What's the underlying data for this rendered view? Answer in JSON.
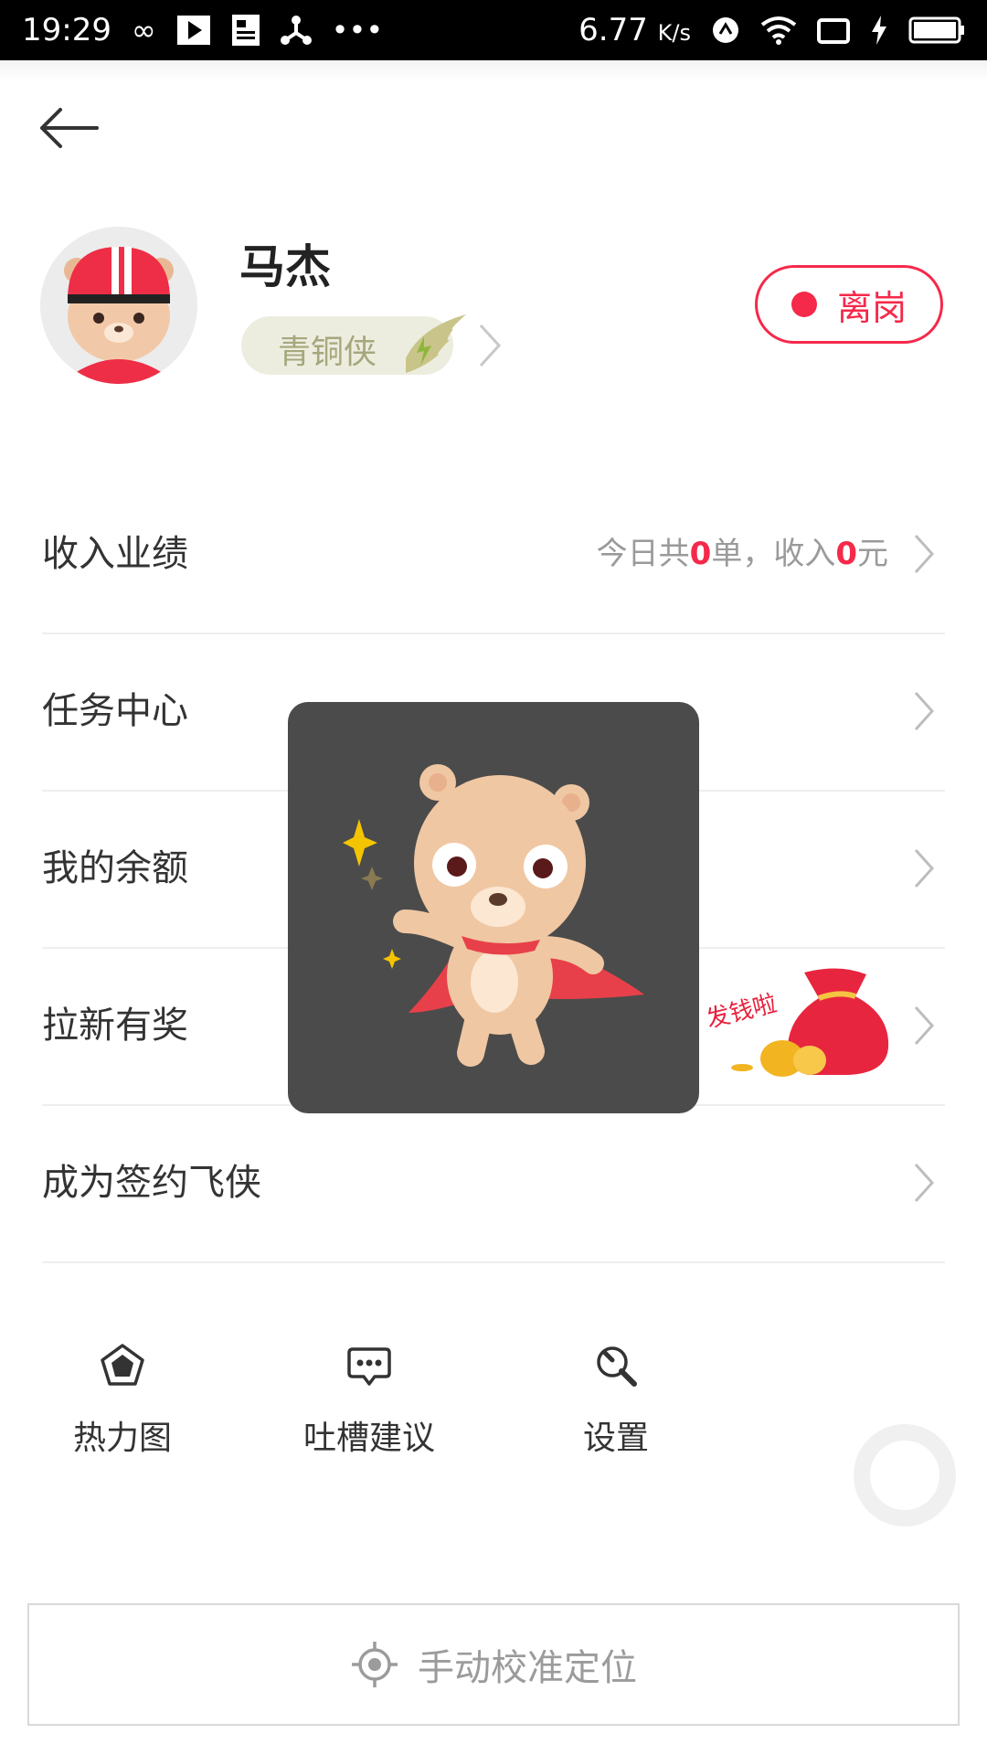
{
  "statusbar": {
    "time": "19:29",
    "speed": "6.77",
    "speed_unit": "K/s",
    "icons": [
      "infinity-icon",
      "play-icon",
      "news-icon",
      "share-node-icon",
      "more-dots-icon",
      "data-arrows-icon",
      "wifi-icon",
      "screen-icon",
      "charging-icon",
      "battery-icon"
    ]
  },
  "profile": {
    "name": "马杰",
    "level": "青铜侠",
    "status_button": "离岗"
  },
  "menu": {
    "income": {
      "label": "收入业绩",
      "summary_prefix": "今日共",
      "orders": "0",
      "summary_mid": "单，收入",
      "amount": "0",
      "summary_suffix": "元"
    },
    "tasks": "任务中心",
    "balance": "我的余额",
    "referral": "拉新有奖",
    "referral_badge": "发钱啦",
    "contract": "成为签约飞侠"
  },
  "quick_actions": {
    "heatmap": "热力图",
    "feedback": "吐槽建议",
    "settings": "设置"
  },
  "locate_button": "手动校准定位",
  "colors": {
    "accent": "#f5294a",
    "level_text": "#a6a77c",
    "level_bg": "#ededdf",
    "toast_bg": "#4b4b4b"
  }
}
